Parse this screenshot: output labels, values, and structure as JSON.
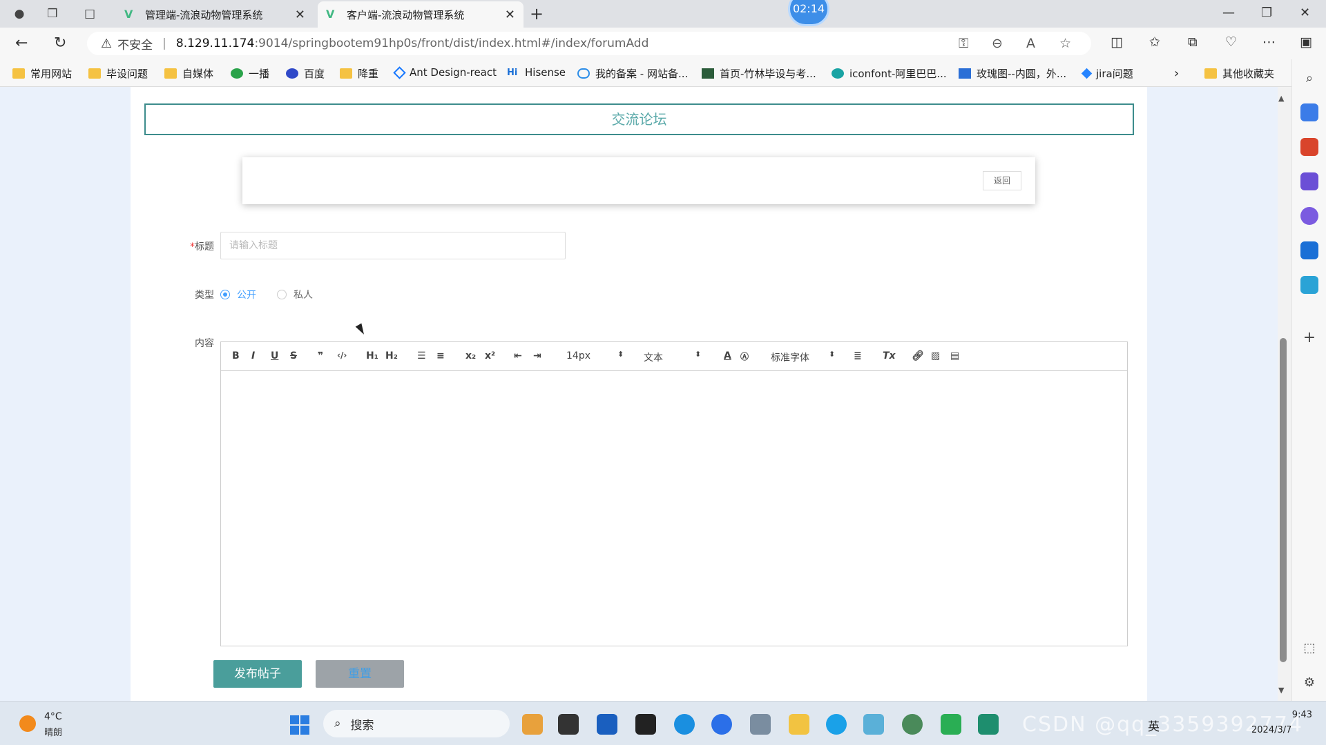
{
  "browser": {
    "tabs": [
      {
        "title": "管理端-流浪动物管理系统",
        "active": false
      },
      {
        "title": "客户端-流浪动物管理系统",
        "active": true
      }
    ],
    "clock": "02:14",
    "security_label": "不安全",
    "url_host": "8.129.11.174",
    "url_path": ":9014/springbootem91hp0s/front/dist/index.html#/index/forumAdd",
    "bookmarks": [
      "常用网站",
      "毕设问题",
      "自媒体",
      "一播",
      "百度",
      "降重",
      "Ant Design-react",
      "Hisense",
      "我的备案 - 网站备...",
      "首页-竹林毕设与考...",
      "iconfont-阿里巴巴...",
      "玫瑰图--内圆，外...",
      "jira问题",
      "其他收藏夹"
    ]
  },
  "page": {
    "banner_title": "交流论坛",
    "back_label": "返回",
    "form": {
      "title_label": "标题",
      "title_placeholder": "请输入标题",
      "type_label": "类型",
      "type_options": [
        "公开",
        "私人"
      ],
      "type_selected": "公开",
      "content_label": "内容"
    },
    "editor": {
      "font_size": "14px",
      "block_format": "文本",
      "font_family": "标准字体"
    },
    "buttons": {
      "publish": "发布帖子",
      "reset": "重置"
    }
  },
  "taskbar": {
    "temperature": "4°C",
    "weather": "晴朗",
    "search_label": "搜索",
    "ime": "英",
    "time": "9:43",
    "date": "2024/3/7",
    "watermark": "CSDN @qq_3359392774"
  },
  "colors": {
    "banner_border": "#3c8c8c",
    "publish_bg": "#4a9e9b",
    "radio_active": "#409eff",
    "page_bg": "#eaf1fb"
  }
}
